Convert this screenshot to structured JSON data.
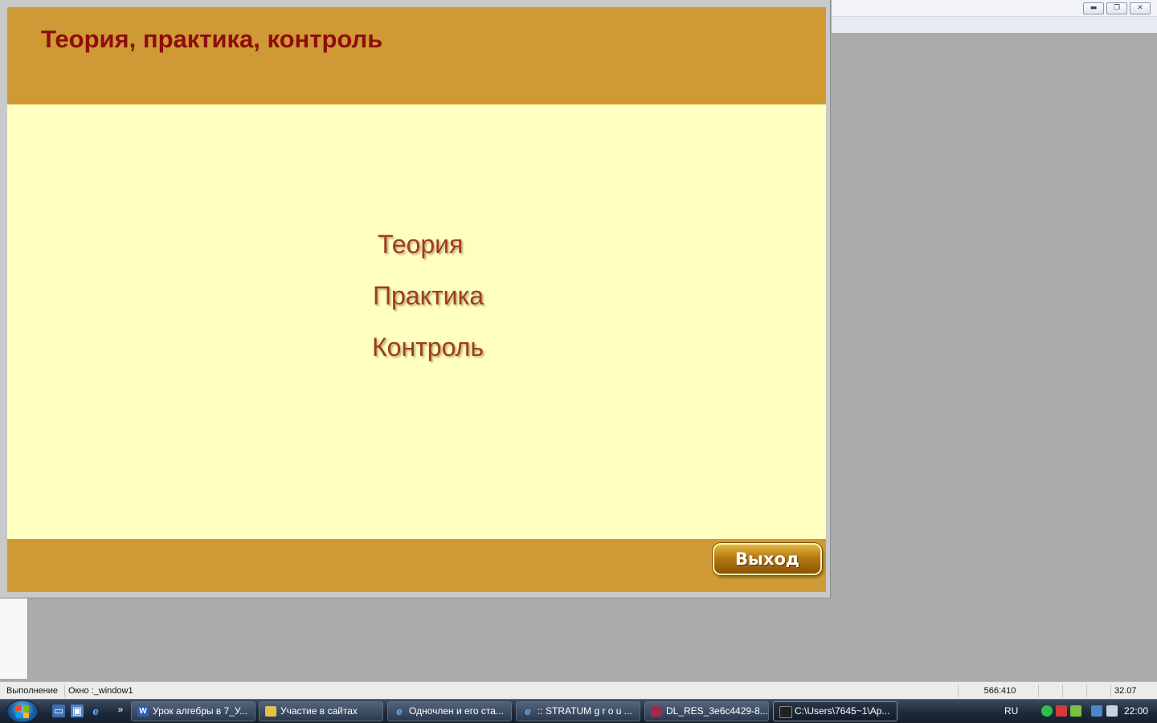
{
  "window": {
    "title": "Теория, практика, контроль",
    "menu": [
      {
        "label": "Теория"
      },
      {
        "label": "Практика"
      },
      {
        "label": "Контроль"
      }
    ],
    "exit_label": "Выход"
  },
  "mdi_controls": {
    "minimize": "▬",
    "restore": "❐",
    "close": "✕"
  },
  "status_bar": {
    "mode": "Выполнение",
    "window_name": "Окно :_window1",
    "cursor_pos": "566:410",
    "value": "32.07"
  },
  "taskbar": {
    "quicklaunch_more": "»",
    "tasks": [
      {
        "label": "Урок алгебры в 7_У...",
        "icon": "word-icon",
        "icon_color": "#2b5fb0"
      },
      {
        "label": "Участие в сайтах",
        "icon": "folder-icon",
        "icon_color": "#e6c04b"
      },
      {
        "label": "Одночлен и его ста...",
        "icon": "ie-icon",
        "icon_color": "#2f8fe0"
      },
      {
        "label": ":: STRATUM g r o u ...",
        "icon": "ie-icon",
        "icon_color": "#2f8fe0"
      },
      {
        "label": "DL_RES_3e6c4429-8...",
        "icon": "winrar-icon",
        "icon_color": "#a02a4f"
      },
      {
        "label": "C:\\Users\\7645~1\\Ap...",
        "icon": "cmd-icon",
        "icon_color": "#222222"
      }
    ],
    "tray": {
      "language": "RU",
      "clock": "22:00"
    }
  },
  "colors": {
    "header_band": "#cf9a35",
    "content_bg": "#ffffc0",
    "title_text": "#8e0d0d",
    "menu_text": "#9c3d1f"
  }
}
